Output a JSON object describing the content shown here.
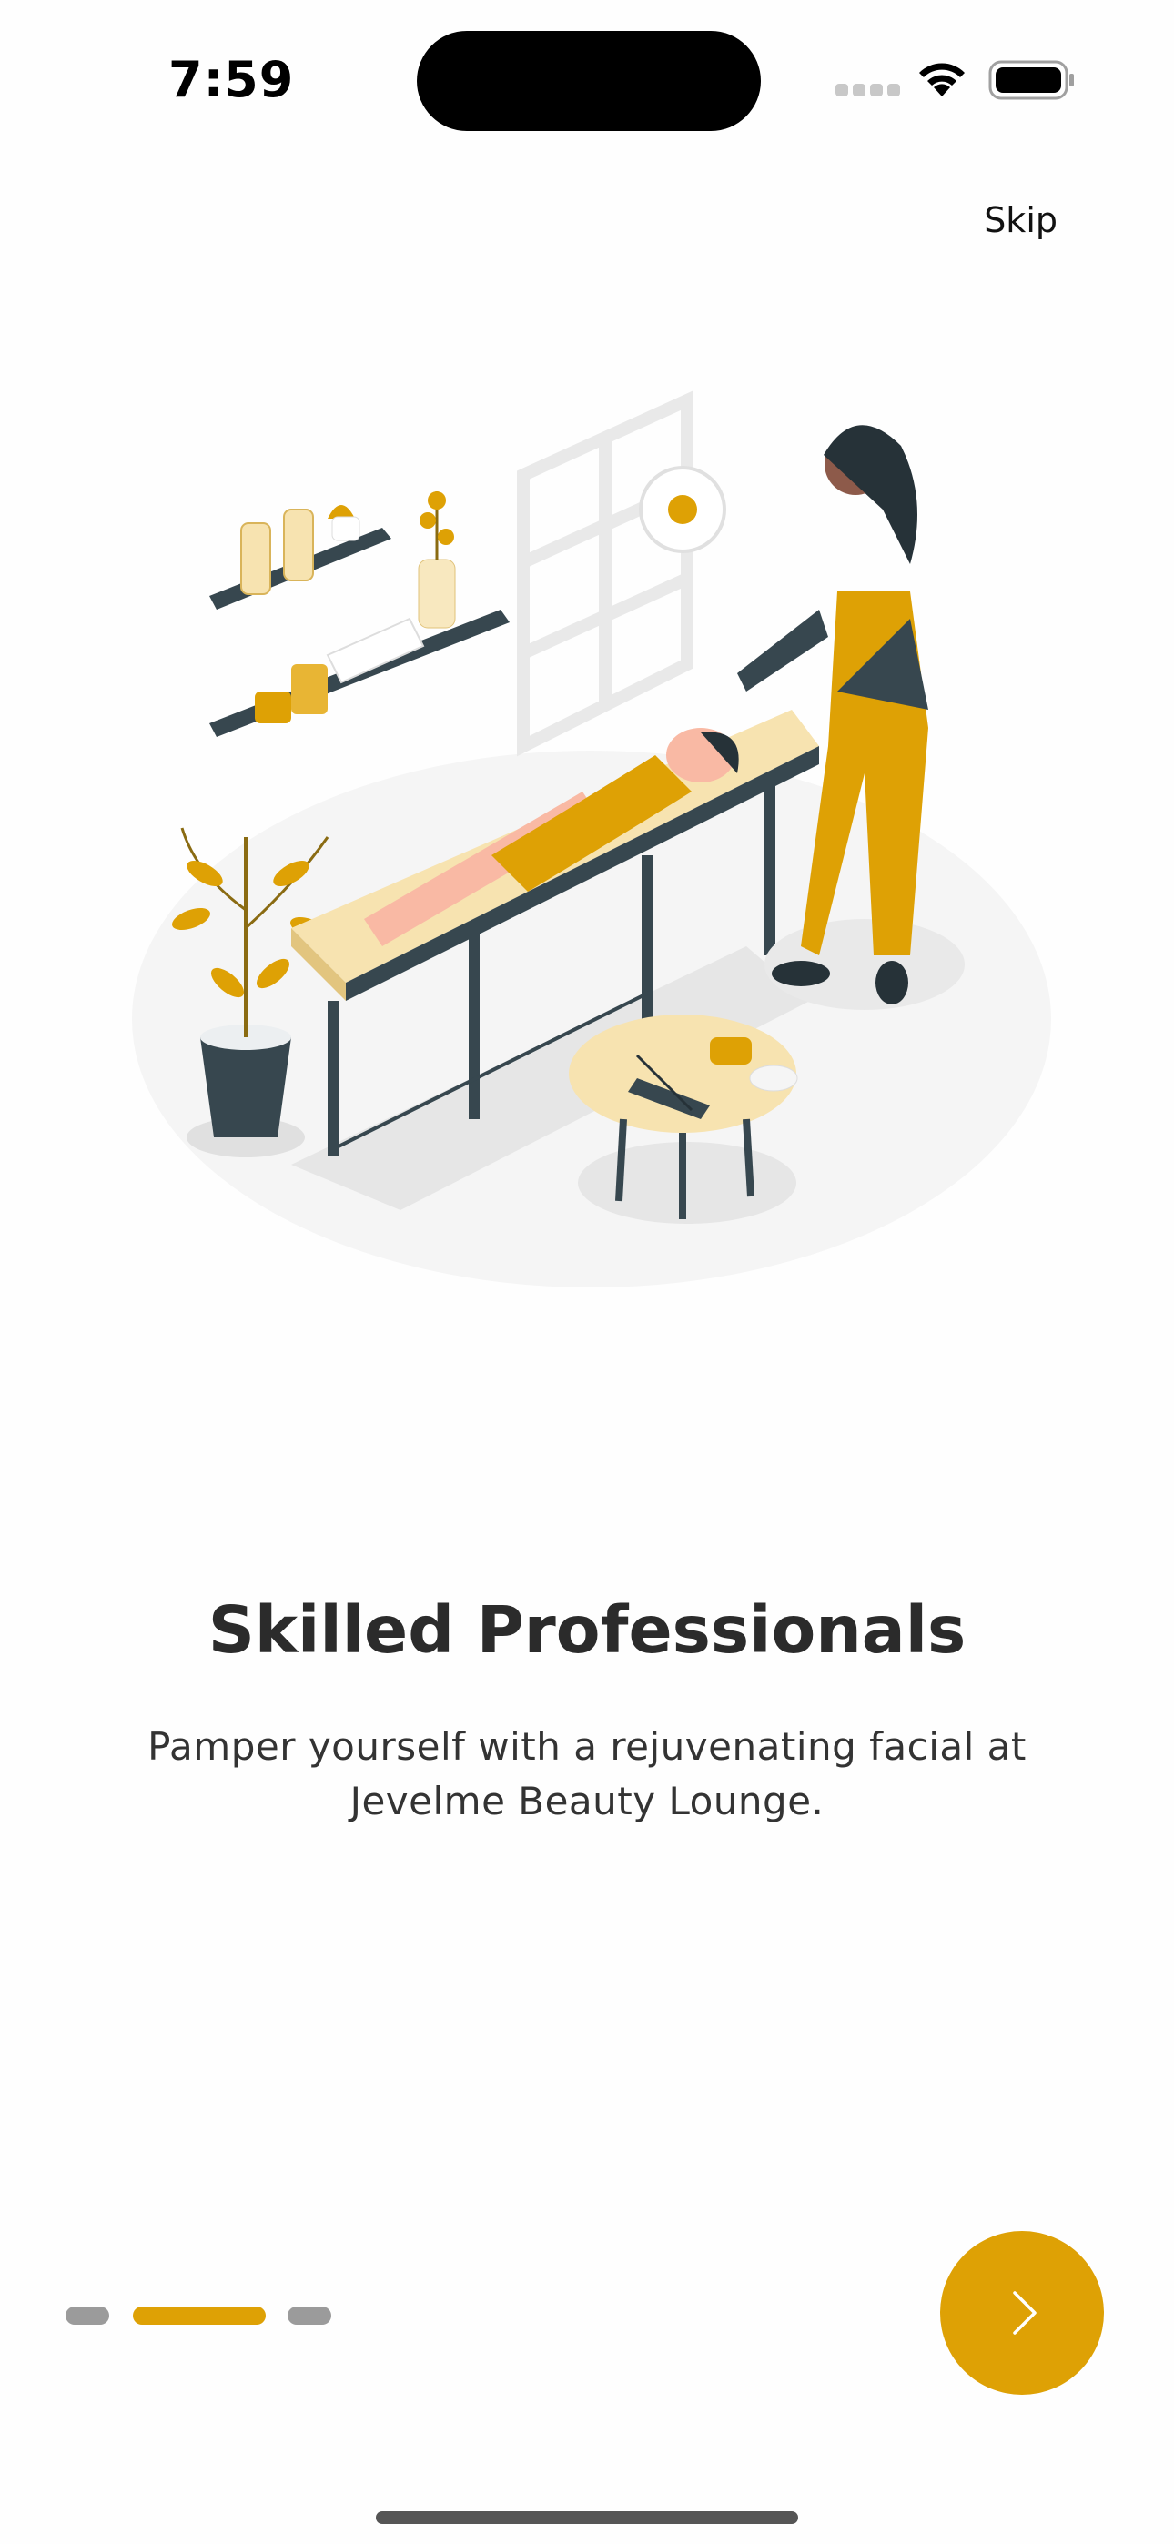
{
  "status_bar": {
    "time": "7:59",
    "signal_icon": "cellular-signal-icon",
    "wifi_icon": "wifi-icon",
    "battery_icon": "battery-full-icon"
  },
  "header": {
    "skip_label": "Skip"
  },
  "illustration": {
    "subject": "spa-facial-illustration"
  },
  "content": {
    "title": "Skilled Professionals",
    "description": "Pamper yourself with a rejuvenating facial at Jevelme Beauty Lounge."
  },
  "pager": {
    "total_pages": 3,
    "active_index": 1
  },
  "next_button": {
    "icon": "chevron-right-icon"
  },
  "colors": {
    "accent": "#dea105",
    "inactive_dot": "#9b9b9b",
    "text": "#2b2b2b",
    "background": "#fefefe"
  }
}
